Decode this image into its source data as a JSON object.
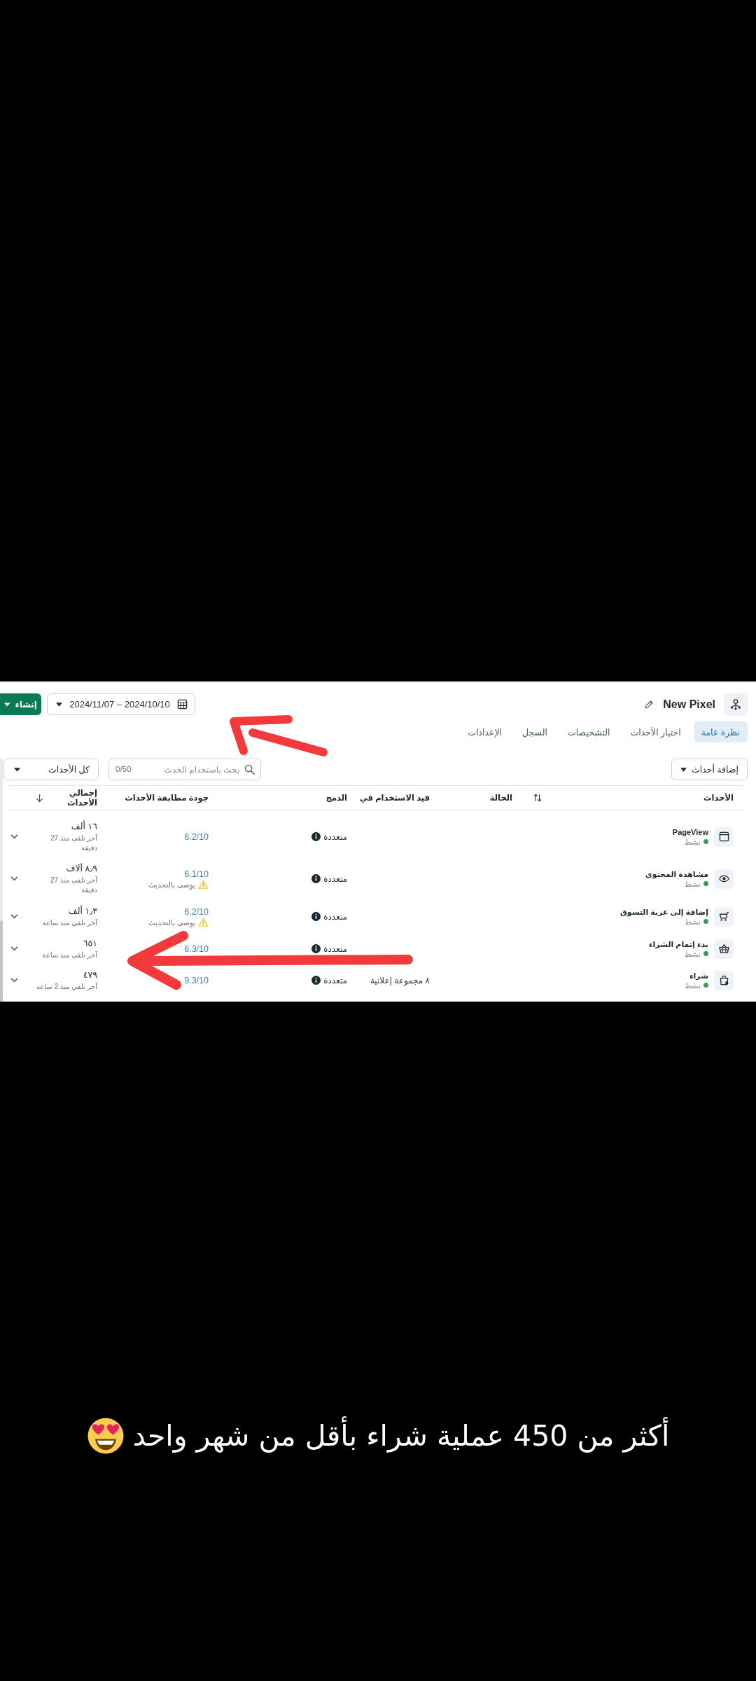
{
  "header": {
    "title": "New Pixel",
    "date_range": "2024/11/07 – 2024/10/10",
    "create_button": "إنشاء"
  },
  "tabs": [
    {
      "label": "نظرة عامة",
      "selected": true
    },
    {
      "label": "اختبار الأحداث",
      "selected": false
    },
    {
      "label": "التشخيصات",
      "selected": false
    },
    {
      "label": "السجل",
      "selected": false
    },
    {
      "label": "الإعدادات",
      "selected": false
    }
  ],
  "toolbar": {
    "add_events": "إضافة أحداث",
    "search": {
      "placeholder": "بحث باستخدام الحدث",
      "counter": "0/50"
    },
    "filter": "كل الأحداث"
  },
  "table": {
    "columns": [
      {
        "label": "الأحداث",
        "sortable": true,
        "sorted": false
      },
      {
        "label": "الحالة"
      },
      {
        "label": "قيد الاستخدام في"
      },
      {
        "label": "الدمج"
      },
      {
        "label": "جودة مطابقة الأحداث"
      },
      {
        "label": "إجمالي الأحداث",
        "sortable": true,
        "sorted": true
      }
    ],
    "rows": [
      {
        "kind": "pageview",
        "name": "PageView",
        "status": "نشط",
        "merge": "متعددة",
        "quality": "6.2/10",
        "total": "١٦ ألف",
        "last_received": "آخر تلقي منذ 27 دقيقة",
        "expanded": false
      },
      {
        "kind": "viewcontent",
        "name": "مشاهدة المحتوى",
        "status": "نشط",
        "merge": "متعددة",
        "quality": "6.1/10",
        "recommendation": "يوصى بالتحديث",
        "total": "٨٫٩ آلاف",
        "last_received": "آخر تلقي منذ 27 دقيقة",
        "expanded": false
      },
      {
        "kind": "addtocart",
        "name": "إضافة إلى عربة التسوق",
        "status": "نشط",
        "merge": "متعددة",
        "quality": "6.2/10",
        "recommendation": "يوصى بالتحديث",
        "total": "١٫٣ ألف",
        "last_received": "آخر تلقي منذ ساعة",
        "expanded": false
      },
      {
        "kind": "checkout",
        "name": "بدء إتمام الشراء",
        "status": "نشط",
        "merge": "متعددة",
        "quality": "6.3/10",
        "total": "٦٥١",
        "last_received": "آخر تلقي منذ ساعة",
        "expanded": false
      },
      {
        "kind": "purchase",
        "name": "شراء",
        "status": "نشط",
        "in_use": "٨ مجموعة إعلانية",
        "merge": "متعددة",
        "quality": "9.3/10",
        "total": "٤٧٩",
        "last_received": "آخر تلقي منذ 2 ساعة",
        "expanded": false
      }
    ]
  },
  "caption": "أكثر من 450 عملية شراء بأقل من شهر واحد"
}
